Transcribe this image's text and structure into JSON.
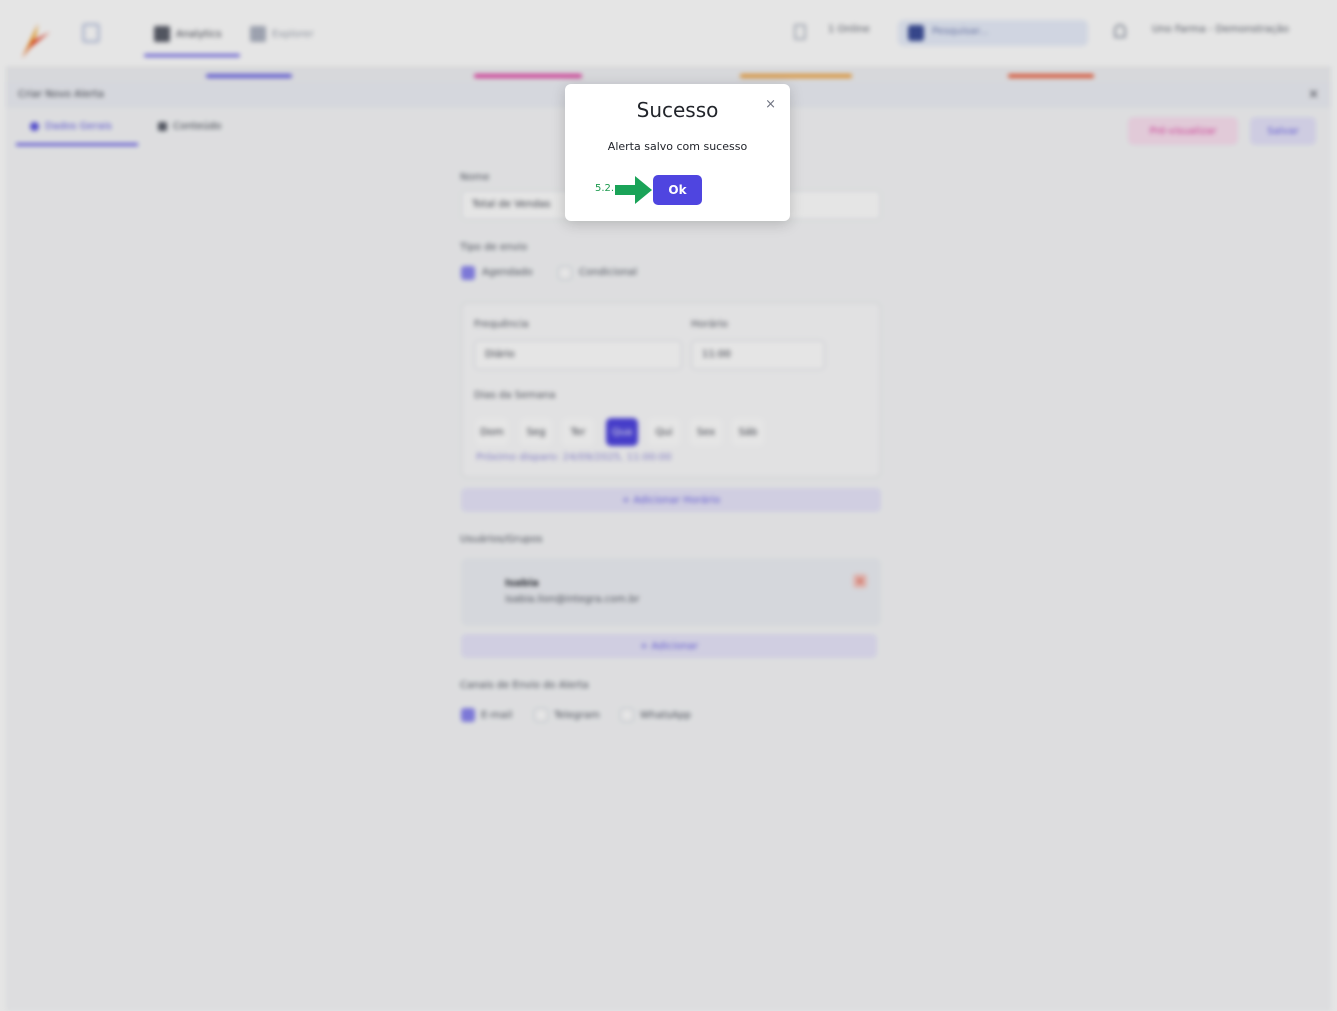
{
  "topbar": {
    "nav_tabs": [
      "Analytics",
      "Explorer"
    ],
    "notifications_label": "1 Online",
    "search_placeholder": "Pesquisar...",
    "user_label": "Uno Farma - Demonstração"
  },
  "panel": {
    "title": "Criar Novo Alerta",
    "tabs": [
      "Dados Gerais",
      "Conteúdo"
    ],
    "buttons": [
      "Pré-visualizar",
      "Salvar"
    ]
  },
  "form": {
    "name_label": "Nome",
    "name_value": "Total de Vendas",
    "send_type_label": "Tipo de envio",
    "send_type_options": [
      "Agendado",
      "Condicional"
    ],
    "frequency_label": "Frequência",
    "frequency_value": "Diário",
    "time_label": "Horário",
    "time_value": "11:00",
    "weekdays_label": "Dias da Semana",
    "weekdays": [
      "Dom",
      "Seg",
      "Ter",
      "Qua",
      "Qui",
      "Sex",
      "Sáb"
    ],
    "next_send": "Próximo disparo: 24/09/2025, 11:00:00",
    "add_schedule": "+ Adicionar Horário",
    "users_label": "Usuários/Grupos",
    "user_name": "Isabia",
    "user_email": "isabia.lion@integra.com.br",
    "add_user": "+ Adicionar",
    "channels_label": "Canais de Envio do Alerta",
    "channels": [
      "E-mail",
      "Telegram",
      "WhatsApp"
    ]
  },
  "modal": {
    "title": "Sucesso",
    "message": "Alerta salvo com sucesso",
    "ok_label": "Ok",
    "close_glyph": "×",
    "step_label": "5.2."
  },
  "colors": {
    "accent": "#4f45e0",
    "step_green": "#1c9a4e"
  }
}
